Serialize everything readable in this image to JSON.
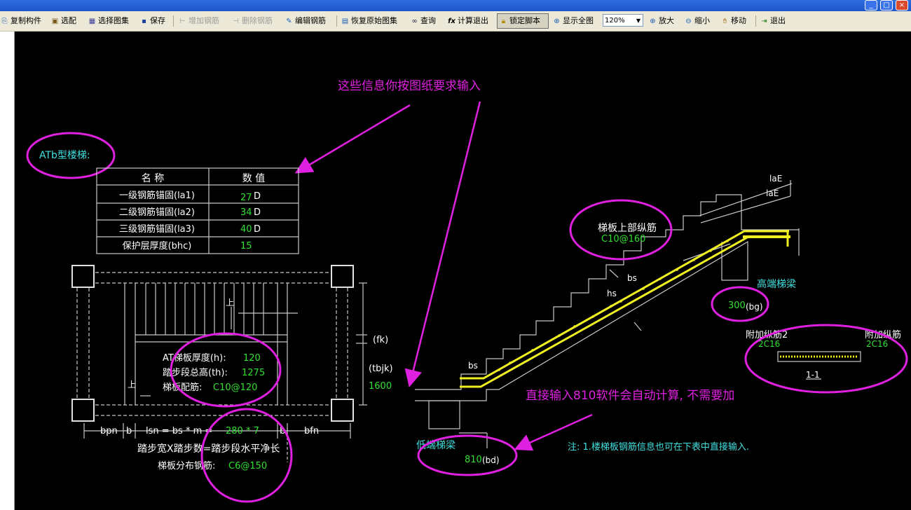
{
  "window": {
    "minimize": "_",
    "maximize": "□",
    "close": "×"
  },
  "toolbar": {
    "copy": "复制构件",
    "auto": "选配",
    "select_atlas": "选择图集",
    "save": "保存",
    "add_rebar": "增加钢筋",
    "del_rebar": "删除钢筋",
    "edit_rebar": "编辑钢筋",
    "restore_atlas": "恢复原始图集",
    "query": "查询",
    "calc_exit": "计算退出",
    "lock_script": "锁定脚本",
    "show_all": "显示全图",
    "zoom": "120%",
    "zoom_in": "放大",
    "zoom_out": "缩小",
    "move": "移动",
    "exit": "退出"
  },
  "drawing": {
    "annotation_top": "这些信息你按图纸要求输入",
    "annotation_bottom": "直接输入810软件会自动计算, 不需要加",
    "stair_type": "ATb型楼梯:",
    "table": {
      "h_name": "名 称",
      "h_value": "数 值",
      "rows": [
        {
          "name": "一级钢筋锚固(la1)",
          "value": "27",
          "unit": "D"
        },
        {
          "name": "二级钢筋锚固(la2)",
          "value": "34",
          "unit": "D"
        },
        {
          "name": "三级钢筋锚固(la3)",
          "value": "40",
          "unit": "D"
        },
        {
          "name": "保护层厚度(bhc)",
          "value": "15",
          "unit": ""
        }
      ]
    },
    "plan": {
      "up1": "上",
      "up2": "上",
      "thickness_label": "AT梯板厚度(h):",
      "thickness_value": "120",
      "height_label": "踏步段总高(th):",
      "height_value": "1275",
      "rebar_label": "梯板配筋:",
      "rebar_value": "C10@120",
      "fk": "(fk)",
      "tbjk": "(tbjk)",
      "tbjk_value": "1600",
      "bpn": "bpn",
      "b1": "b",
      "lsn": "lsn = bs * m =",
      "lsn_value": "280 * 7",
      "b2": "b",
      "bfn": "bfn",
      "formula": "踏步宽X踏步数=踏步段水平净长",
      "dist_label": "梯板分布钢筋:",
      "dist_value": "C6@150"
    },
    "section": {
      "laE1": "laE",
      "laE2": "laE",
      "top_rebar_label": "梯板上部纵筋",
      "top_rebar_value": "C10@160",
      "high_beam": "高端梯梁",
      "bg_value": "300",
      "bg_label": "(bg)",
      "bs1": "bs",
      "hs": "hs",
      "bs2": "bs",
      "extra2": "附加纵筋2",
      "extra2_value": "2C16",
      "extra1": "附加纵筋",
      "extra1_value": "2C16",
      "section_mark": "1-1",
      "low_beam": "低端梯梁",
      "bd_value": "810",
      "bd_label": "(bd)",
      "note": "注: 1.楼梯板钢筋信息也可在下表中直接输入."
    }
  }
}
